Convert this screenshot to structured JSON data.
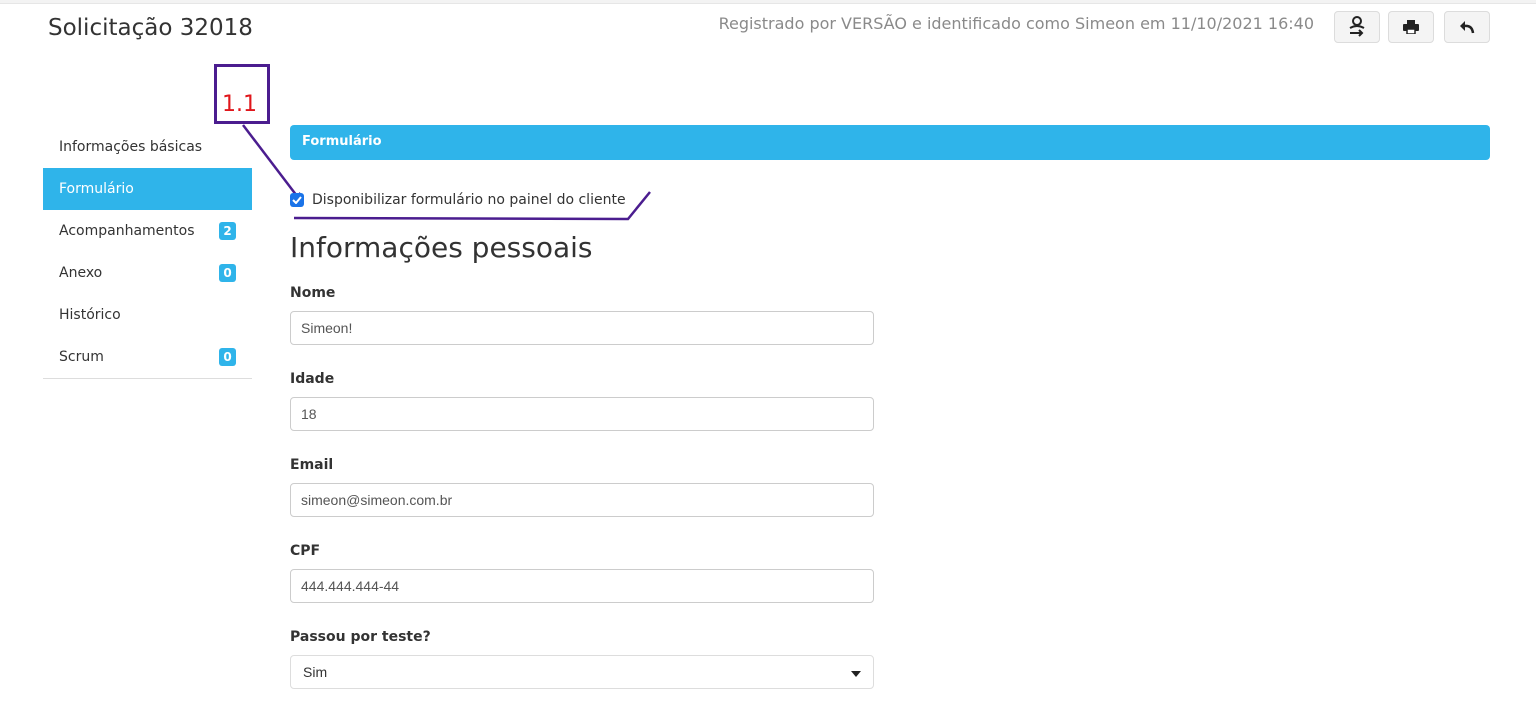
{
  "header": {
    "title": "Solicitação 32018",
    "registered_text": "Registrado por VERSÃO e identificado como Simeon em 11/10/2021 16:40",
    "buttons": [
      {
        "icon": "transfer-user-icon"
      },
      {
        "icon": "print-icon"
      },
      {
        "icon": "reply-back-icon"
      }
    ]
  },
  "annotation": {
    "label": "1.1",
    "box_color": "#4b1d8f",
    "label_color": "#e0161b"
  },
  "sidebar": {
    "items": [
      {
        "label": "Informações básicas",
        "badge": null,
        "active": false
      },
      {
        "label": "Formulário",
        "badge": null,
        "active": true
      },
      {
        "label": "Acompanhamentos",
        "badge": "2",
        "active": false
      },
      {
        "label": "Anexo",
        "badge": "0",
        "active": false
      },
      {
        "label": "Histórico",
        "badge": null,
        "active": false
      },
      {
        "label": "Scrum",
        "badge": "0",
        "active": false
      }
    ]
  },
  "form": {
    "panel_title": "Formulário",
    "checkbox_label": "Disponibilizar formulário no painel do cliente",
    "checkbox_checked": true,
    "section_title": "Informações pessoais",
    "fields": [
      {
        "label": "Nome",
        "value": "Simeon!"
      },
      {
        "label": "Idade",
        "value": "18"
      },
      {
        "label": "Email",
        "value": "simeon@simeon.com.br"
      },
      {
        "label": "CPF",
        "value": "444.444.444-44"
      }
    ],
    "select": {
      "label": "Passou por teste?",
      "value": "Sim"
    }
  },
  "colors": {
    "accent": "#2fb4ea",
    "checkbox": "#1a73e8"
  }
}
